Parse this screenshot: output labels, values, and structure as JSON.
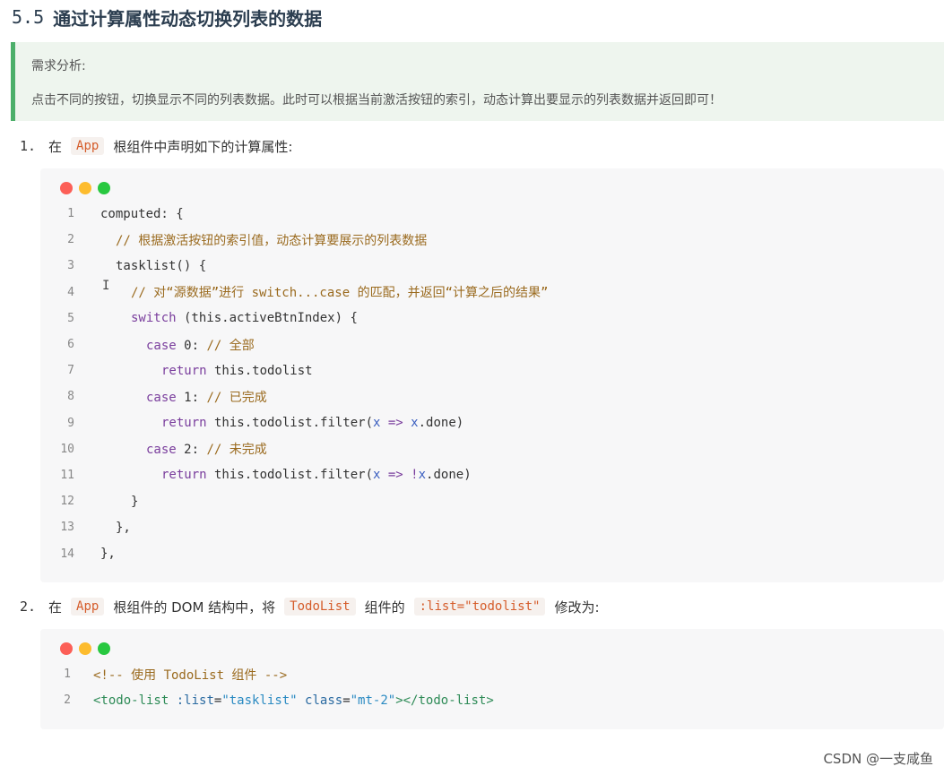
{
  "heading": {
    "number": "5.5",
    "title": "通过计算属性动态切换列表的数据"
  },
  "tip": {
    "label": "需求分析:",
    "text": "点击不同的按钮，切换显示不同的列表数据。此时可以根据当前激活按钮的索引，动态计算出要显示的列表数据并返回即可！"
  },
  "step1": {
    "number": "1.",
    "pre": "在",
    "chip": "App",
    "post": "根组件中声明如下的计算属性:"
  },
  "code1": {
    "line_numbers": [
      "1",
      "2",
      "3",
      "4",
      "5",
      "6",
      "7",
      "8",
      "9",
      "10",
      "11",
      "12",
      "13",
      "14"
    ],
    "l1": "computed: {",
    "l2": "// 根据激活按钮的索引值，动态计算要展示的列表数据",
    "l3": "tasklist() {",
    "l4": "// 对“源数据”进行 switch...case 的匹配，并返回“计算之后的结果”",
    "l5a": "switch",
    "l5b": " (this.activeBtnIndex) {",
    "l6a": "case",
    "l6b": " 0: ",
    "l6c": "// 全部",
    "l7a": "return",
    "l7b": " this.todolist",
    "l8a": "case",
    "l8b": " 1: ",
    "l8c": "// 已完成",
    "l9a": "return",
    "l9b": " this.todolist.filter(",
    "l9c": "x",
    "l9d": " => ",
    "l9e": "x",
    "l9f": ".done)",
    "l10a": "case",
    "l10b": " 2: ",
    "l10c": "// 未完成",
    "l11a": "return",
    "l11b": " this.todolist.filter(",
    "l11c": "x",
    "l11d": " => !",
    "l11e": "x",
    "l11f": ".done)",
    "l12": "}",
    "l13": "},",
    "l14": "},"
  },
  "step2": {
    "number": "2.",
    "pre": "在",
    "chip1": "App",
    "mid1": "根组件的 DOM 结构中，将",
    "chip2": "TodoList",
    "mid2": "组件的",
    "chip3": ":list=\"todolist\"",
    "post": "修改为:"
  },
  "code2": {
    "line_numbers": [
      "1",
      "2"
    ],
    "l1": "<!-- 使用 TodoList 组件 -->",
    "l2a": "<todo-list",
    "l2b": " :list",
    "l2c": "=",
    "l2d": "\"tasklist\"",
    "l2e": " class",
    "l2f": "=",
    "l2g": "\"mt-2\"",
    "l2h": "></todo-list>"
  },
  "watermark": "CSDN @一支咸鱼"
}
